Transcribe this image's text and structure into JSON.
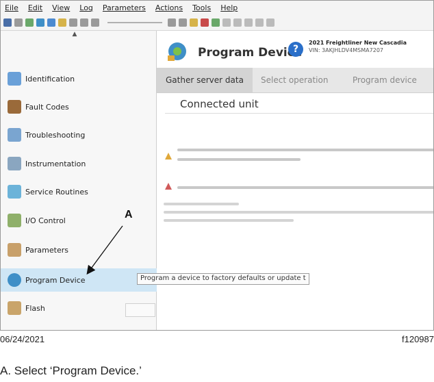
{
  "menu": [
    "Eile",
    "Edit",
    "View",
    "Log",
    "Parameters",
    "Actions",
    "Tools",
    "Help"
  ],
  "sidebar": {
    "items": [
      {
        "label": "Identification",
        "icon": "id-card-icon",
        "color": "#6aa0d8"
      },
      {
        "label": "Fault Codes",
        "icon": "fault-codes-icon",
        "color": "#9a6a3a"
      },
      {
        "label": "Troubleshooting",
        "icon": "stethoscope-icon",
        "color": "#7aa5d0"
      },
      {
        "label": "Instrumentation",
        "icon": "chart-icon",
        "color": "#8aa6c0"
      },
      {
        "label": "Service Routines",
        "icon": "gears-icon",
        "color": "#6cb3d9"
      },
      {
        "label": "I/O Control",
        "icon": "io-gears-icon",
        "color": "#8fb06a"
      },
      {
        "label": "Parameters",
        "icon": "pencil-icon",
        "color": "#c8a06a"
      },
      {
        "label": "Program Device",
        "icon": "program-device-icon",
        "color": "#3f8fc7"
      },
      {
        "label": "Flash",
        "icon": "folder-icon",
        "color": "#c9a46a"
      }
    ],
    "tooltip": "Program a device to factory defaults or update t"
  },
  "main": {
    "title": "Program Device",
    "vehicle": "2021 Freightliner New Cascadia",
    "vin": "VIN: 3AKJHLDV4MSMA7207",
    "tabs": [
      "Gather server data",
      "Select operation",
      "Program device"
    ],
    "section": "Connected unit"
  },
  "annotation": {
    "letter": "A"
  },
  "footer": {
    "date": "06/24/2021",
    "figure": "f120987"
  },
  "caption": "A. Select ‘Program Device.’"
}
